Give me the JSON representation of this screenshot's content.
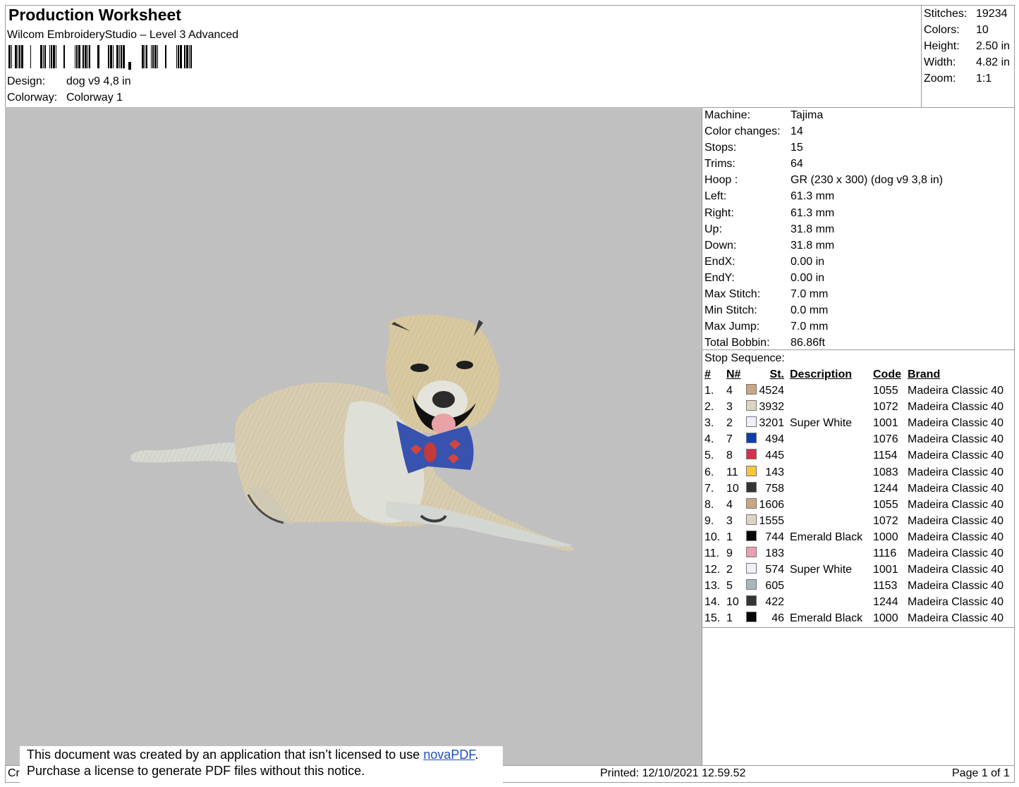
{
  "header": {
    "title": "Production Worksheet",
    "software": "Wilcom EmbroideryStudio – Level 3 Advanced",
    "design_label": "Design:",
    "design_value": "dog v9 4,8 in",
    "colorway_label": "Colorway:",
    "colorway_value": "Colorway 1"
  },
  "stats": [
    {
      "label": "Stitches:",
      "value": "19234"
    },
    {
      "label": "Colors:",
      "value": "10"
    },
    {
      "label": "Height:",
      "value": "2.50 in"
    },
    {
      "label": "Width:",
      "value": "4.82 in"
    },
    {
      "label": "Zoom:",
      "value": "1:1"
    }
  ],
  "machine_info": [
    {
      "label": "Machine:",
      "value": "Tajima"
    },
    {
      "label": "Color changes:",
      "value": "14"
    },
    {
      "label": "Stops:",
      "value": "15"
    },
    {
      "label": "Trims:",
      "value": "64"
    },
    {
      "label": "Hoop :",
      "value": "GR (230 x 300) (dog v9 3,8 in)"
    },
    {
      "label": "Left:",
      "value": "61.3 mm"
    },
    {
      "label": "Right:",
      "value": "61.3 mm"
    },
    {
      "label": "Up:",
      "value": "31.8 mm"
    },
    {
      "label": "Down:",
      "value": "31.8 mm"
    },
    {
      "label": "EndX:",
      "value": "0.00 in"
    },
    {
      "label": "EndY:",
      "value": "0.00 in"
    },
    {
      "label": "Max Stitch:",
      "value": "7.0 mm"
    },
    {
      "label": "Min Stitch:",
      "value": "0.0 mm"
    },
    {
      "label": "Max Jump:",
      "value": "7.0 mm"
    },
    {
      "label": "Total Bobbin:",
      "value": "86.86ft"
    }
  ],
  "stop_sequence": {
    "title": "Stop Sequence:",
    "headers": {
      "idx": "#",
      "n": "N#",
      "st": "St.",
      "desc": "Description",
      "code": "Code",
      "brand": "Brand"
    },
    "rows": [
      {
        "idx": "1.",
        "n": "4",
        "color": "#c9a684",
        "st": "4524",
        "desc": "",
        "code": "1055",
        "brand": "Madeira Classic 40"
      },
      {
        "idx": "2.",
        "n": "3",
        "color": "#ddd5c2",
        "st": "3932",
        "desc": "",
        "code": "1072",
        "brand": "Madeira Classic 40"
      },
      {
        "idx": "3.",
        "n": "2",
        "color": "#eef0fa",
        "st": "3201",
        "desc": "Super White",
        "code": "1001",
        "brand": "Madeira Classic 40"
      },
      {
        "idx": "4.",
        "n": "7",
        "color": "#0c3fae",
        "st": "494",
        "desc": "",
        "code": "1076",
        "brand": "Madeira Classic 40"
      },
      {
        "idx": "5.",
        "n": "8",
        "color": "#d6304e",
        "st": "445",
        "desc": "",
        "code": "1154",
        "brand": "Madeira Classic 40"
      },
      {
        "idx": "6.",
        "n": "11",
        "color": "#f6c63c",
        "st": "143",
        "desc": "",
        "code": "1083",
        "brand": "Madeira Classic 40"
      },
      {
        "idx": "7.",
        "n": "10",
        "color": "#333438",
        "st": "758",
        "desc": "",
        "code": "1244",
        "brand": "Madeira Classic 40"
      },
      {
        "idx": "8.",
        "n": "4",
        "color": "#c9a684",
        "st": "1606",
        "desc": "",
        "code": "1055",
        "brand": "Madeira Classic 40"
      },
      {
        "idx": "9.",
        "n": "3",
        "color": "#ddd5c2",
        "st": "1555",
        "desc": "",
        "code": "1072",
        "brand": "Madeira Classic 40"
      },
      {
        "idx": "10.",
        "n": "1",
        "color": "#050505",
        "st": "744",
        "desc": "Emerald Black",
        "code": "1000",
        "brand": "Madeira Classic 40"
      },
      {
        "idx": "11.",
        "n": "9",
        "color": "#ec9fb0",
        "st": "183",
        "desc": "",
        "code": "1116",
        "brand": "Madeira Classic 40"
      },
      {
        "idx": "12.",
        "n": "2",
        "color": "#eef0fa",
        "st": "574",
        "desc": "Super White",
        "code": "1001",
        "brand": "Madeira Classic 40"
      },
      {
        "idx": "13.",
        "n": "5",
        "color": "#a9b6be",
        "st": "605",
        "desc": "",
        "code": "1153",
        "brand": "Madeira Classic 40"
      },
      {
        "idx": "14.",
        "n": "10",
        "color": "#333438",
        "st": "422",
        "desc": "",
        "code": "1244",
        "brand": "Madeira Classic 40"
      },
      {
        "idx": "15.",
        "n": "1",
        "color": "#050505",
        "st": "46",
        "desc": "Emerald Black",
        "code": "1000",
        "brand": "Madeira Classic 40"
      }
    ]
  },
  "notice": {
    "line1_prefix": "This document was created by an application that isn’t licensed to use ",
    "link": "novaPDF",
    "line1_suffix": ".",
    "line2": "Purchase a license to generate PDF files without this notice."
  },
  "footer": {
    "left": "Cr",
    "printed_label": "Printed:",
    "printed_value": "12/10/2021 12.59.52",
    "page": "Page 1 of 1"
  },
  "colors": {
    "canvas_bg": "#c0c0c0",
    "border": "#9a9a9a",
    "link": "#1f4fbf"
  }
}
